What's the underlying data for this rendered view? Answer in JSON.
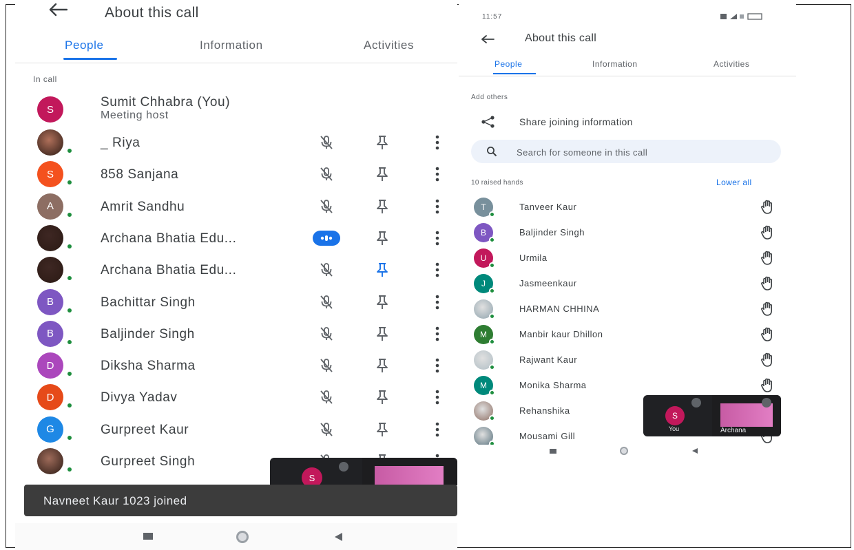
{
  "left": {
    "title": "About this call",
    "tabs": [
      "People",
      "Information",
      "Activities"
    ],
    "section": "In call",
    "host": {
      "initial": "S",
      "name": "Sumit Chhabra (You)",
      "sub": "Meeting host",
      "color": "#c2185b"
    },
    "participants": [
      {
        "initial": "",
        "name": "_ Riya",
        "color": "#b0705a",
        "photo": true
      },
      {
        "initial": "S",
        "name": "858 Sanjana",
        "color": "#f4511e"
      },
      {
        "initial": "A",
        "name": "Amrit Sandhu",
        "color": "#8d6e63"
      },
      {
        "initial": "",
        "name": "Archana Bhatia Edu...",
        "color": "#3e2723",
        "photo": true,
        "speaking": true
      },
      {
        "initial": "",
        "name": "Archana Bhatia Edu...",
        "color": "#3e2723",
        "photo": true,
        "pinned": true
      },
      {
        "initial": "B",
        "name": "Bachittar Singh",
        "color": "#7e57c2"
      },
      {
        "initial": "B",
        "name": "Baljinder Singh",
        "color": "#7e57c2"
      },
      {
        "initial": "D",
        "name": "Diksha Sharma",
        "color": "#ab47bc"
      },
      {
        "initial": "D",
        "name": "Divya Yadav",
        "color": "#e64a19"
      },
      {
        "initial": "G",
        "name": "Gurpreet Kaur",
        "color": "#1e88e5"
      },
      {
        "initial": "",
        "name": "Gurpreet Singh",
        "color": "#9e6b5a",
        "photo": true
      }
    ],
    "toast": "Navneet Kaur 1023 joined",
    "pip_initial": "S"
  },
  "right": {
    "status_time": "11:57",
    "title": "About this call",
    "tabs": [
      "People",
      "Information",
      "Activities"
    ],
    "add_others": "Add others",
    "share": "Share joining information",
    "search_placeholder": "Search for someone in this call",
    "raised_hands": "10 raised hands",
    "lower_all": "Lower all",
    "participants": [
      {
        "initial": "T",
        "name": "Tanveer Kaur",
        "color": "#78909c"
      },
      {
        "initial": "B",
        "name": "Baljinder Singh",
        "color": "#7e57c2"
      },
      {
        "initial": "U",
        "name": "Urmila",
        "color": "#c2185b"
      },
      {
        "initial": "J",
        "name": "Jasmeenkaur",
        "color": "#00897b"
      },
      {
        "initial": "",
        "name": "HARMAN CHHINA",
        "color": "#90a4ae",
        "photo": true
      },
      {
        "initial": "M",
        "name": "Manbir kaur Dhillon",
        "color": "#2e7d32"
      },
      {
        "initial": "",
        "name": "Rajwant Kaur",
        "color": "#b0bec5",
        "photo": true
      },
      {
        "initial": "M",
        "name": "Monika Sharma",
        "color": "#00897b"
      },
      {
        "initial": "",
        "name": "Rehanshika",
        "color": "#8d6e63",
        "photo": true
      },
      {
        "initial": "",
        "name": "Mousami Gill",
        "color": "#546e7a",
        "photo": true
      }
    ],
    "pip_initial": "S",
    "pip_you": "You",
    "pip_other": "Archana"
  }
}
